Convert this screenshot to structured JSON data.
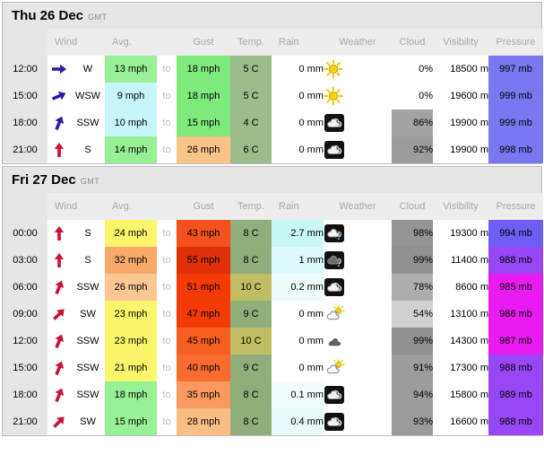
{
  "columns": [
    "Wind",
    "Avg.",
    "Gust",
    "Temp.",
    "Rain",
    "Weather",
    "Cloud",
    "Visibility",
    "Pressure"
  ],
  "to_label": "to",
  "days": [
    {
      "title": "Thu 26 Dec",
      "timezone": "GMT",
      "rows": [
        {
          "time": "12:00",
          "dir": "W",
          "dir_deg": 90,
          "arrow_color": "#2a1ba8",
          "avg": "13 mph",
          "avg_bg": "#97f096",
          "gust": "18 mph",
          "gust_bg": "#7eea7c",
          "temp": "5 C",
          "temp_bg": "#9dbc8b",
          "rain": "0 mm",
          "rain_bg": "#ffffff",
          "weather": "sunny-icon",
          "cloud": "0%",
          "cloud_bg": "#ffffff",
          "vis": "18500 m",
          "pres": "997 mb",
          "pres_bg": "#7a77f0"
        },
        {
          "time": "15:00",
          "dir": "WSW",
          "dir_deg": 67,
          "arrow_color": "#2a1ba8",
          "avg": "9 mph",
          "avg_bg": "#c6f5fb",
          "gust": "18 mph",
          "gust_bg": "#7eea7c",
          "temp": "5 C",
          "temp_bg": "#9dbc8b",
          "rain": "0 mm",
          "rain_bg": "#ffffff",
          "weather": "sunny-icon",
          "cloud": "0%",
          "cloud_bg": "#ffffff",
          "vis": "19600 m",
          "pres": "999 mb",
          "pres_bg": "#7a77f0"
        },
        {
          "time": "18:00",
          "dir": "SSW",
          "dir_deg": 22,
          "arrow_color": "#2a1ba8",
          "avg": "10 mph",
          "avg_bg": "#c6f5fb",
          "gust": "15 mph",
          "gust_bg": "#7eea7c",
          "temp": "4 C",
          "temp_bg": "#9dbc8b",
          "rain": "0 mm",
          "rain_bg": "#ffffff",
          "weather": "night-cloudy-icon",
          "cloud": "86%",
          "cloud_bg": "#a3a3a3",
          "vis": "19900 m",
          "pres": "999 mb",
          "pres_bg": "#7a77f0"
        },
        {
          "time": "21:00",
          "dir": "S",
          "dir_deg": 0,
          "arrow_color": "#cc1133",
          "avg": "14 mph",
          "avg_bg": "#97f096",
          "gust": "26 mph",
          "gust_bg": "#f9c48a",
          "temp": "6 C",
          "temp_bg": "#9dbc8b",
          "rain": "0 mm",
          "rain_bg": "#ffffff",
          "weather": "night-cloudy-icon",
          "cloud": "92%",
          "cloud_bg": "#9c9c9c",
          "vis": "19900 m",
          "pres": "998 mb",
          "pres_bg": "#7a77f0"
        }
      ]
    },
    {
      "title": "Fri 27 Dec",
      "timezone": "GMT",
      "rows": [
        {
          "time": "00:00",
          "dir": "S",
          "dir_deg": 0,
          "arrow_color": "#cc1133",
          "avg": "24 mph",
          "avg_bg": "#fbf56c",
          "gust": "43 mph",
          "gust_bg": "#f4511e",
          "temp": "8 C",
          "temp_bg": "#8fae7c",
          "rain": "2.7 mm",
          "rain_bg": "#c9f7f7",
          "weather": "night-rain-icon",
          "cloud": "98%",
          "cloud_bg": "#949494",
          "vis": "19300 m",
          "pres": "994 mb",
          "pres_bg": "#6f5ef5"
        },
        {
          "time": "03:00",
          "dir": "S",
          "dir_deg": 0,
          "arrow_color": "#cc1133",
          "avg": "32 mph",
          "avg_bg": "#f9a96a",
          "gust": "55 mph",
          "gust_bg": "#df3008",
          "temp": "8 C",
          "temp_bg": "#8fae7c",
          "rain": "1 mm",
          "rain_bg": "#dcfafa",
          "weather": "night-rain-dark-icon",
          "cloud": "99%",
          "cloud_bg": "#919191",
          "vis": "11400 m",
          "pres": "988 mb",
          "pres_bg": "#9747f5"
        },
        {
          "time": "06:00",
          "dir": "SSW",
          "dir_deg": 22,
          "arrow_color": "#cc1133",
          "avg": "26 mph",
          "avg_bg": "#fbc793",
          "gust": "51 mph",
          "gust_bg": "#f53b05",
          "temp": "10 C",
          "temp_bg": "#c1bd62",
          "rain": "0.2 mm",
          "rain_bg": "#eefcfc",
          "weather": "night-cloudy-icon",
          "cloud": "78%",
          "cloud_bg": "#adadad",
          "vis": "8600 m",
          "pres": "985 mb",
          "pres_bg": "#ea1bf0"
        },
        {
          "time": "09:00",
          "dir": "SW",
          "dir_deg": 45,
          "arrow_color": "#cc1133",
          "avg": "23 mph",
          "avg_bg": "#fbf56c",
          "gust": "47 mph",
          "gust_bg": "#f53b05",
          "temp": "9 C",
          "temp_bg": "#8fae7c",
          "rain": "0 mm",
          "rain_bg": "#ffffff",
          "weather": "sun-cloud-icon",
          "cloud": "54%",
          "cloud_bg": "#d1d1d1",
          "vis": "13100 m",
          "pres": "986 mb",
          "pres_bg": "#ea1bf0"
        },
        {
          "time": "12:00",
          "dir": "SSW",
          "dir_deg": 22,
          "arrow_color": "#cc1133",
          "avg": "23 mph",
          "avg_bg": "#fbf56c",
          "gust": "45 mph",
          "gust_bg": "#f75f22",
          "temp": "10 C",
          "temp_bg": "#c1bd62",
          "rain": "0 mm",
          "rain_bg": "#ffffff",
          "weather": "overcast-icon",
          "cloud": "99%",
          "cloud_bg": "#919191",
          "vis": "14300 m",
          "pres": "987 mb",
          "pres_bg": "#ea1bf0"
        },
        {
          "time": "15:00",
          "dir": "SSW",
          "dir_deg": 22,
          "arrow_color": "#cc1133",
          "avg": "21 mph",
          "avg_bg": "#fbf56c",
          "gust": "40 mph",
          "gust_bg": "#f96b2e",
          "temp": "9 C",
          "temp_bg": "#8fae7c",
          "rain": "0 mm",
          "rain_bg": "#ffffff",
          "weather": "sun-cloud-icon",
          "cloud": "91%",
          "cloud_bg": "#9c9c9c",
          "vis": "17300 m",
          "pres": "988 mb",
          "pres_bg": "#9747f5"
        },
        {
          "time": "18:00",
          "dir": "SSW",
          "dir_deg": 22,
          "arrow_color": "#cc1133",
          "avg": "18 mph",
          "avg_bg": "#97f096",
          "gust": "35 mph",
          "gust_bg": "#fb9a5e",
          "temp": "8 C",
          "temp_bg": "#8fae7c",
          "rain": "0.1 mm",
          "rain_bg": "#f2fdfd",
          "weather": "night-cloudy-icon",
          "cloud": "94%",
          "cloud_bg": "#9c9c9c",
          "vis": "15800 m",
          "pres": "989 mb",
          "pres_bg": "#9747f5"
        },
        {
          "time": "21:00",
          "dir": "SW",
          "dir_deg": 45,
          "arrow_color": "#cc1133",
          "avg": "15 mph",
          "avg_bg": "#97f096",
          "gust": "28 mph",
          "gust_bg": "#fbbd86",
          "temp": "8 C",
          "temp_bg": "#8fae7c",
          "rain": "0.4 mm",
          "rain_bg": "#e8fbfb",
          "weather": "night-cloudy-icon",
          "cloud": "93%",
          "cloud_bg": "#9c9c9c",
          "vis": "16600 m",
          "pres": "988 mb",
          "pres_bg": "#9747f5"
        }
      ]
    }
  ]
}
